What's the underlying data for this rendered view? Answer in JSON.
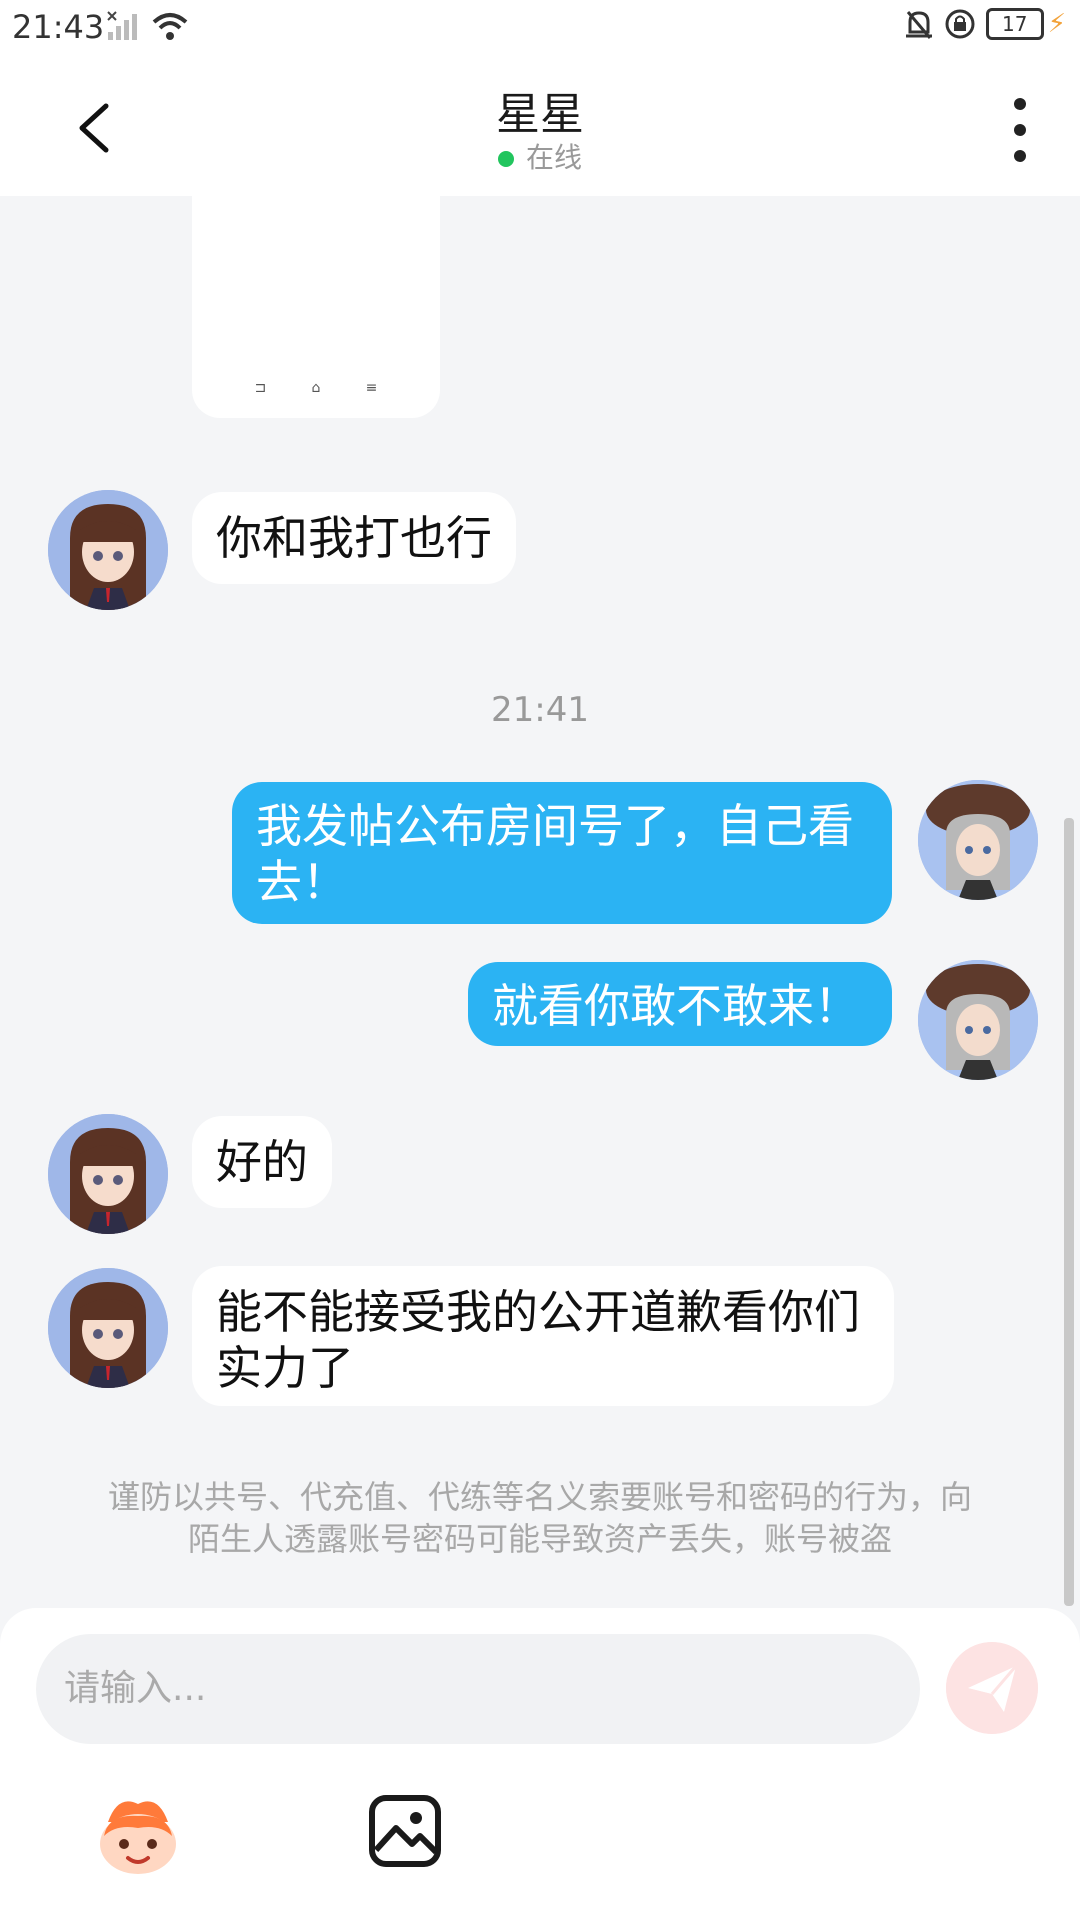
{
  "status_bar": {
    "time": "21:43",
    "battery": "17"
  },
  "header": {
    "title": "星星",
    "status": "在线"
  },
  "messages": {
    "m1": "你和我打也行",
    "time": "21:41",
    "m2": "我发帖公布房间号了，自己看去！",
    "m3": "就看你敢不敢来！",
    "m4": "好的",
    "m5": "能不能接受我的公开道歉看你们实力了"
  },
  "warning": "谨防以共号、代充值、代练等名义索要账号和密码的行为，向陌生人透露账号密码可能导致资产丢失，账号被盗",
  "input": {
    "placeholder": "请输入..."
  },
  "colors": {
    "accent": "#2bb3f3",
    "online": "#22c55e",
    "send": "#fde3e3"
  }
}
